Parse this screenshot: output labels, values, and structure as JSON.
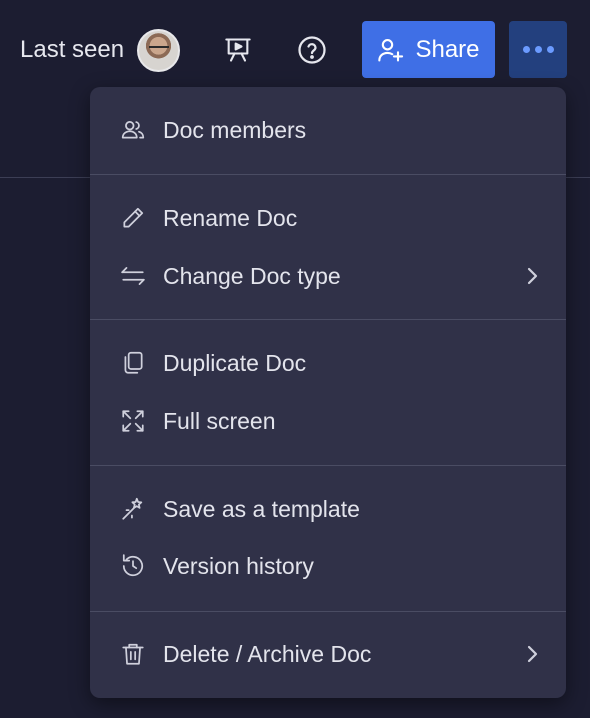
{
  "header": {
    "last_seen_label": "Last seen",
    "present_icon": "presentation-icon",
    "help_icon": "help-icon",
    "share_label": "Share",
    "share_icon": "add-user-icon",
    "more_icon": "more-horizontal-icon",
    "accent_color": "#3f6fe6"
  },
  "menu": {
    "sections": [
      {
        "items": [
          {
            "label": "Doc members",
            "icon": "users-icon",
            "has_submenu": false
          }
        ]
      },
      {
        "items": [
          {
            "label": "Rename Doc",
            "icon": "pencil-icon",
            "has_submenu": false
          },
          {
            "label": "Change Doc type",
            "icon": "swap-arrows-icon",
            "has_submenu": true
          }
        ]
      },
      {
        "items": [
          {
            "label": "Duplicate Doc",
            "icon": "copy-icon",
            "has_submenu": false
          },
          {
            "label": "Full screen",
            "icon": "expand-icon",
            "has_submenu": false
          }
        ]
      },
      {
        "items": [
          {
            "label": "Save as a template",
            "icon": "magic-wand-icon",
            "has_submenu": false
          },
          {
            "label": "Version history",
            "icon": "history-icon",
            "has_submenu": false
          }
        ]
      },
      {
        "items": [
          {
            "label": "Delete / Archive Doc",
            "icon": "trash-icon",
            "has_submenu": true
          }
        ]
      }
    ]
  }
}
